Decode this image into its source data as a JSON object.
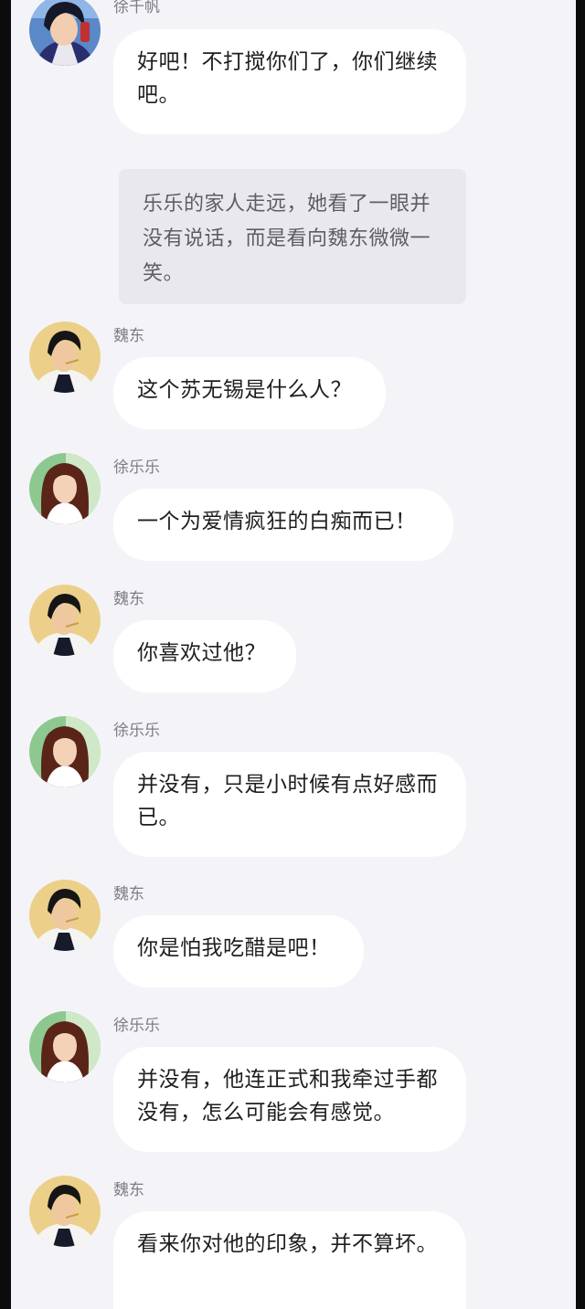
{
  "messages": [
    {
      "sender": "徐千帆",
      "text": "好吧！不打搅你们了，你们继续吧。",
      "avatar_icon": "boy-avatar-icon"
    },
    {
      "sender": "魏东",
      "text": "这个苏无锡是什么人？",
      "avatar_icon": "wei-dong-avatar-icon"
    },
    {
      "sender": "徐乐乐",
      "text": "一个为爱情疯狂的白痴而已！",
      "avatar_icon": "xu-lele-avatar-icon"
    },
    {
      "sender": "魏东",
      "text": "你喜欢过他？",
      "avatar_icon": "wei-dong-avatar-icon"
    },
    {
      "sender": "徐乐乐",
      "text": "并没有，只是小时候有点好感而已。",
      "avatar_icon": "xu-lele-avatar-icon"
    },
    {
      "sender": "魏东",
      "text": "你是怕我吃醋是吧！",
      "avatar_icon": "wei-dong-avatar-icon"
    },
    {
      "sender": "徐乐乐",
      "text": "并没有，他连正式和我牵过手都没有，怎么可能会有感觉。",
      "avatar_icon": "xu-lele-avatar-icon"
    },
    {
      "sender": "魏东",
      "text": "看来你对他的印象，并不算坏。",
      "avatar_icon": "wei-dong-avatar-icon"
    }
  ],
  "narration": "乐乐的家人走远，她看了一眼并没有说话，而是看向魏东微微一笑。",
  "colors": {
    "background": "#f4f4f8",
    "bubble": "#ffffff",
    "narration_bg": "#e9e9ed",
    "sender_text": "#7c7c84"
  }
}
